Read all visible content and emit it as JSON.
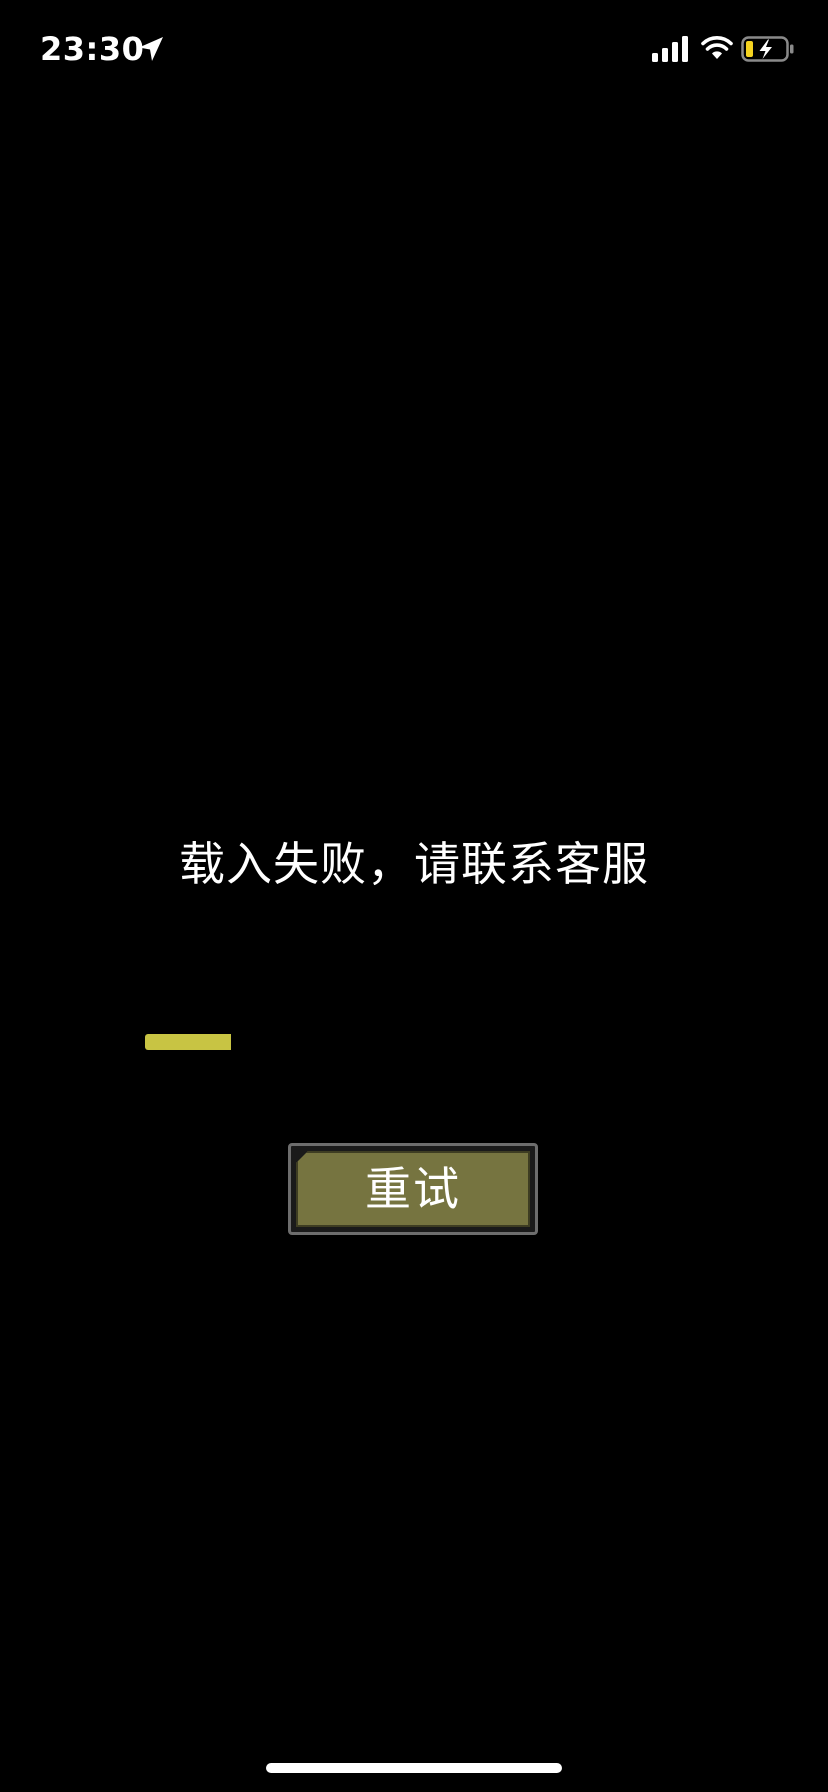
{
  "status_bar": {
    "time": "23:30",
    "location_icon": "location-arrow-icon",
    "signal_icon": "cellular-signal-icon",
    "wifi_icon": "wifi-icon",
    "battery_icon": "battery-charging-icon"
  },
  "main": {
    "error_message": "载入失败，请联系客服",
    "progress": 0.16,
    "progress_color": "#c8c443",
    "retry_label": "重试",
    "button_color": "#767440"
  }
}
